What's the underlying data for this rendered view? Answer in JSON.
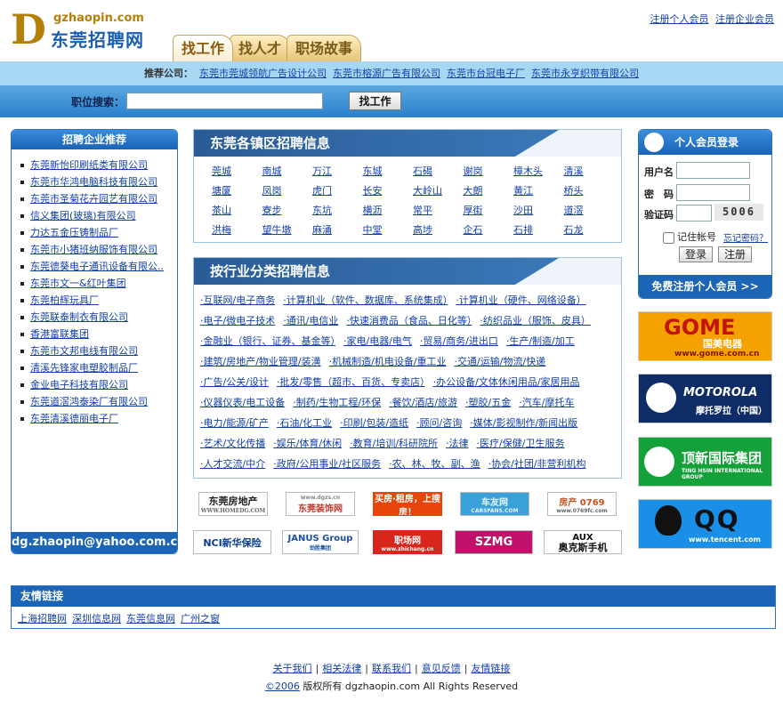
{
  "logo": {
    "letter": "D",
    "domain": "gzhaopin.com",
    "name": "东莞招聘网"
  },
  "top_links": [
    "注册个人会员",
    "注册企业会员"
  ],
  "tabs": [
    "找工作",
    "找人才",
    "职场故事"
  ],
  "recommend": {
    "label": "推荐公司：",
    "items": [
      "东莞市莞城领航广告设计公司",
      "东莞市榕源广告有限公司",
      "东莞市台冠电子厂",
      "东莞市永亨织带有限公司"
    ]
  },
  "search": {
    "label": "职位搜索：",
    "value": "",
    "button": "找工作"
  },
  "left": {
    "title": "招聘企业推荐",
    "items": [
      "东莞新怡印刷纸类有限公司",
      "东莞市华鸿电脑科技有限公司",
      "东莞市圣菊花卉园艺有限公司",
      "信义集团(玻璃)有限公司",
      "力达五金压铸制品厂",
      "东莞市小猪班纳服饰有限公司",
      "东莞德葵电子通讯设备有限公..",
      "东莞市文一&红叶集团",
      "东莞柏辉玩具厂",
      "东莞联泰制衣有限公司",
      "香港富联集团",
      "东莞市文邦电线有限公司",
      "清溪先锋家电塑胶制品厂",
      "金业电子科技有限公司",
      "东莞道滘鸿泰染厂有限公司",
      "东莞清溪德丽电子厂"
    ],
    "footer": "dg.zhaopin@yahoo.com.cn"
  },
  "towns": {
    "title": "东莞各镇区招聘信息",
    "items": [
      "莞城",
      "南城",
      "万江",
      "东城",
      "石碣",
      "谢岗",
      "樟木头",
      "清溪",
      "塘厦",
      "凤岗",
      "虎门",
      "长安",
      "大岭山",
      "大朗",
      "黄江",
      "桥头",
      "茶山",
      "寮步",
      "东坑",
      "横沥",
      "常平",
      "厚街",
      "沙田",
      "道滘",
      "洪梅",
      "望牛墩",
      "麻涌",
      "中堂",
      "高埗",
      "企石",
      "石排",
      "石龙"
    ]
  },
  "industries": {
    "title": "按行业分类招聘信息",
    "rows": [
      [
        "·互联网/电子商务",
        "·计算机业（软件、数据库、系统集成）",
        "·计算机业（硬件、网络设备）"
      ],
      [
        "·电子/微电子技术",
        "·通讯/电信业",
        "·快速消费品（食品、日化等）",
        "·纺织品业（服饰、皮具）"
      ],
      [
        "·金融业（银行、证券、基金等）",
        "·家电/电器/电气",
        "·贸易/商务/进出口",
        "·生产/制造/加工"
      ],
      [
        "·建筑/房地产/物业管理/装潢",
        "·机械制造/机电设备/重工业",
        "·交通/运输/物流/快递"
      ],
      [
        "·广告/公关/设计",
        "·批发/零售（超市、百货、专卖店）",
        "·办公设备/文体休闲用品/家居用品"
      ],
      [
        "·仪器仪表/电工设备",
        "·制药/生物工程/环保",
        "·餐饮/酒店/旅游",
        "·塑胶/五金",
        "·汽车/摩托车"
      ],
      [
        "·电力/能源/矿产",
        "·石油/化工业",
        "·印刷/包装/造纸",
        "·顾问/咨询",
        "·媒体/影视制作/新闻出版"
      ],
      [
        "·艺术/文化传播",
        "·娱乐/体育/休闲",
        "·教育/培训/科研院所",
        "·法律",
        "·医疗/保健/卫生服务"
      ],
      [
        "·人才交流/中介",
        "·政府/公用事业/社区服务",
        "·农、林、牧、副、渔",
        "·协会/社团/非营利机构"
      ]
    ]
  },
  "partner_logos": [
    {
      "text": "东莞房地产",
      "sub": "WWW.HOMEDG.COM"
    },
    {
      "text": "东莞装饰网",
      "sub": "www.dgzs.cn"
    },
    {
      "text": "买房·租房，上搜房！",
      "sub": ""
    },
    {
      "text": "车友网",
      "sub": "CARSFANS.COM"
    },
    {
      "text": "房产 0769",
      "sub": "www.0769fc.com"
    },
    {
      "text": "NCI新华保险",
      "sub": ""
    },
    {
      "text": "JANUS Group",
      "sub": "劲胜集团"
    },
    {
      "text": "职场网",
      "sub": "www.zhichang.cn"
    },
    {
      "text": "SZMG",
      "sub": ""
    },
    {
      "text": "AUX",
      "sub": "奥克斯手机"
    }
  ],
  "login": {
    "title": "个人会员登录",
    "user_label": "用户名",
    "pass_label": "密　码",
    "code_label": "验证码",
    "captcha": "5006",
    "remember": "记住帐号",
    "forgot": "忘记密码？",
    "login_btn": "登录",
    "register_btn": "注册",
    "footer": "免费注册个人会员 >>"
  },
  "ads": [
    {
      "title": "GOME",
      "sub": "国美电器",
      "url": "www.gome.com.cn"
    },
    {
      "title": "MOTOROLA",
      "sub": "摩托罗拉（中国）",
      "url": ""
    },
    {
      "title": "顶新国际集团",
      "sub": "TING HSIN INTERNATIONAL GROUP",
      "url": ""
    },
    {
      "title": "QQ",
      "sub": "",
      "url": "www.tencent.com"
    }
  ],
  "friends": {
    "title": "友情链接",
    "items": [
      "上海招聘网",
      "深圳信息网",
      "东莞信息网",
      "广州之窗"
    ]
  },
  "footer": {
    "links": [
      "关于我们",
      "相关法律",
      "联系我们",
      "意见反馈",
      "友情链接"
    ],
    "year": "©2006",
    "copyright": "版权所有 dgzhaopin.com All Rights Reserved"
  },
  "colors": {
    "brand_blue": "#1b64b6",
    "brand_gold": "#b38109",
    "link": "#1340a8"
  }
}
